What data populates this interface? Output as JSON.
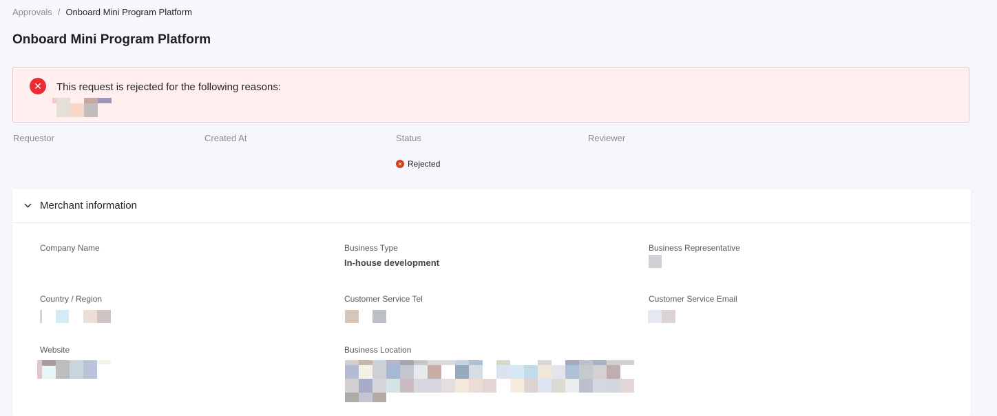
{
  "breadcrumb": {
    "parent": "Approvals",
    "separator": "/",
    "current": "Onboard Mini Program Platform"
  },
  "page_title": "Onboard Mini Program Platform",
  "alert": {
    "icon": "close-circle-icon",
    "message": "This request is rejected for the following reasons:"
  },
  "meta": {
    "requestor_label": "Requestor",
    "created_at_label": "Created At",
    "status_label": "Status",
    "reviewer_label": "Reviewer",
    "status_value": "Rejected",
    "status_color": "#d4411e"
  },
  "merchant": {
    "section_title": "Merchant information",
    "company_name_label": "Company Name",
    "business_type_label": "Business Type",
    "business_type_value": "In-house development",
    "business_rep_label": "Business Representative",
    "country_label": "Country / Region",
    "cs_tel_label": "Customer Service Tel",
    "cs_email_label": "Customer Service Email",
    "website_label": "Website",
    "business_location_label": "Business Location"
  },
  "colors": {
    "background": "#f5f7fc",
    "alert_bg": "#fff0ef",
    "alert_border": "#f5c5c2",
    "error": "#ec2b34"
  }
}
